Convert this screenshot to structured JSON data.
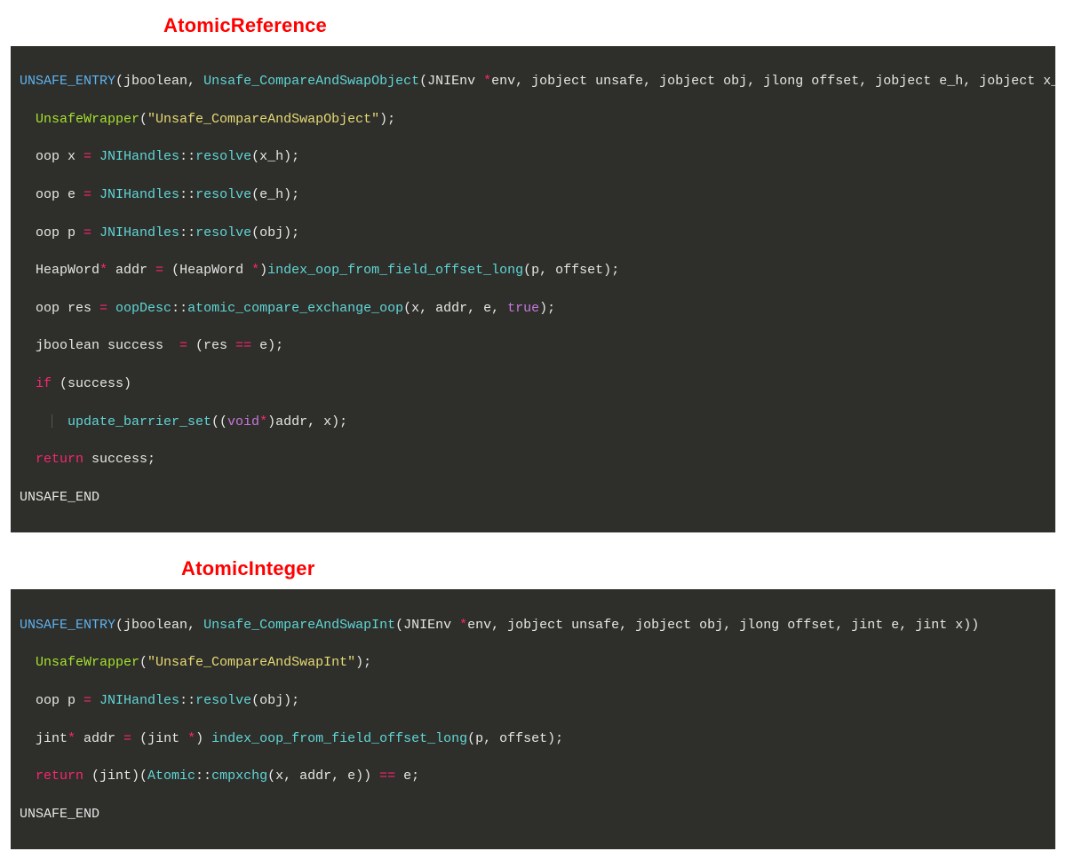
{
  "headings": {
    "h1": "AtomicReference",
    "h2": "AtomicInteger"
  },
  "colors": {
    "heading": "#ff0000",
    "code_bg": "#2e2e2a",
    "code_default": "#e6e6e6",
    "code_blue": "#5fb3f0",
    "code_cyan": "#5fd7d7",
    "code_yellow": "#e6db74",
    "code_green": "#a6e22e",
    "code_keyword": "#c678dd",
    "code_red": "#f92672"
  },
  "block1": {
    "l0": {
      "a": "UNSAFE_ENTRY",
      "b": "(jboolean, ",
      "c": "Unsafe_CompareAndSwapObject",
      "d": "(JNIEnv ",
      "e": "*",
      "f": "env, jobject unsafe, jobject obj, jlong offset, jobject e_h, jobject x_h))"
    },
    "l1": {
      "a": "UnsafeWrapper",
      "b": "(",
      "c": "\"Unsafe_CompareAndSwapObject\"",
      "d": ");"
    },
    "l2": {
      "a": "oop x ",
      "b": "=",
      "c": " ",
      "d": "JNIHandles",
      "e": "::",
      "f": "resolve",
      "g": "(x_h);"
    },
    "l3": {
      "a": "oop e ",
      "b": "=",
      "c": " ",
      "d": "JNIHandles",
      "e": "::",
      "f": "resolve",
      "g": "(e_h);"
    },
    "l4": {
      "a": "oop p ",
      "b": "=",
      "c": " ",
      "d": "JNIHandles",
      "e": "::",
      "f": "resolve",
      "g": "(obj);"
    },
    "l5": {
      "a": "HeapWord",
      "b": "*",
      "c": " addr ",
      "d": "=",
      "e": " (HeapWord ",
      "f": "*",
      "g": ")",
      "h": "index_oop_from_field_offset_long",
      "i": "(p, offset);"
    },
    "l6": {
      "a": "oop res ",
      "b": "=",
      "c": " ",
      "d": "oopDesc",
      "e": "::",
      "f": "atomic_compare_exchange_oop",
      "g": "(x, addr, e, ",
      "h": "true",
      "i": ");"
    },
    "l7": {
      "a": "jboolean success  ",
      "b": "=",
      "c": " (res ",
      "d": "==",
      "e": " e);"
    },
    "l8": {
      "a": "if",
      "b": " (success)"
    },
    "l9": {
      "a": "update_barrier_set",
      "b": "((",
      "c": "void",
      "d": "*",
      "e": ")addr, x);"
    },
    "l10": {
      "a": "return",
      "b": " success;"
    },
    "l11": "UNSAFE_END"
  },
  "block2": {
    "l0": {
      "a": "UNSAFE_ENTRY",
      "b": "(jboolean, ",
      "c": "Unsafe_CompareAndSwapInt",
      "d": "(JNIEnv ",
      "e": "*",
      "f": "env, jobject unsafe, jobject obj, jlong offset, jint e, jint x))"
    },
    "l1": {
      "a": "UnsafeWrapper",
      "b": "(",
      "c": "\"Unsafe_CompareAndSwapInt\"",
      "d": ");"
    },
    "l2": {
      "a": "oop p ",
      "b": "=",
      "c": " ",
      "d": "JNIHandles",
      "e": "::",
      "f": "resolve",
      "g": "(obj);"
    },
    "l3": {
      "a": "jint",
      "b": "*",
      "c": " addr ",
      "d": "=",
      "e": " (jint ",
      "f": "*",
      "g": ") ",
      "h": "index_oop_from_field_offset_long",
      "i": "(p, offset);"
    },
    "l4": {
      "a": "return",
      "b": " (jint)(",
      "c": "Atomic",
      "d": "::",
      "e": "cmpxchg",
      "f": "(x, addr, e)) ",
      "g": "==",
      "h": " e;"
    },
    "l5": "UNSAFE_END"
  }
}
